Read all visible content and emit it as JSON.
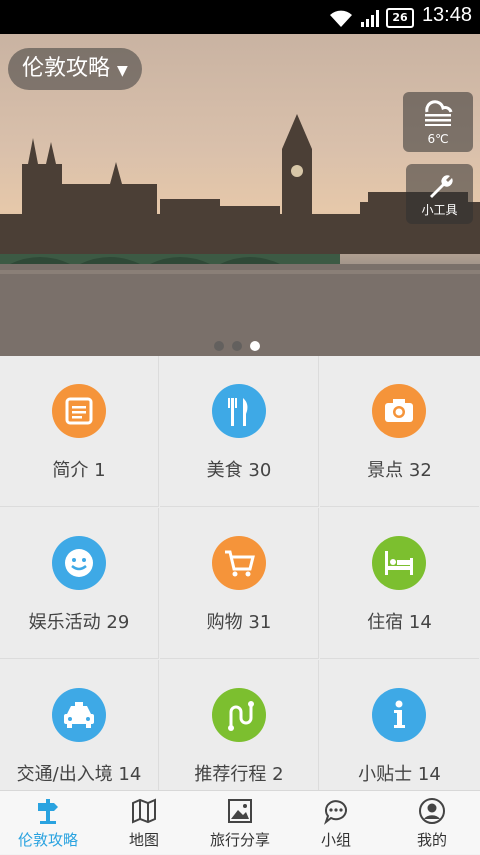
{
  "status_bar": {
    "time": "13:48",
    "battery": "26"
  },
  "hero": {
    "city_label": "伦敦攻略",
    "weather_temp": "6℃",
    "tools_label": "小工具",
    "carousel": {
      "pages": 3,
      "active_index": 2
    }
  },
  "grid": [
    {
      "label": "简介 1",
      "icon": "document-icon",
      "color": "#f5943a"
    },
    {
      "label": "美食 30",
      "icon": "fork-knife-icon",
      "color": "#3ea9e6"
    },
    {
      "label": "景点 32",
      "icon": "camera-icon",
      "color": "#f5943a"
    },
    {
      "label": "娱乐活动 29",
      "icon": "smiley-icon",
      "color": "#3ea9e6"
    },
    {
      "label": "购物 31",
      "icon": "cart-icon",
      "color": "#f5943a"
    },
    {
      "label": "住宿 14",
      "icon": "bed-icon",
      "color": "#7cbf2f"
    },
    {
      "label": "交通/出入境 14",
      "icon": "car-icon",
      "color": "#3ea9e6"
    },
    {
      "label": "推荐行程 2",
      "icon": "route-icon",
      "color": "#7cbf2f"
    },
    {
      "label": "小贴士 14",
      "icon": "info-icon",
      "color": "#3ea9e6"
    }
  ],
  "tabs": [
    {
      "label": "伦敦攻略",
      "icon": "signpost-icon",
      "active": true
    },
    {
      "label": "地图",
      "icon": "map-icon",
      "active": false
    },
    {
      "label": "旅行分享",
      "icon": "picture-icon",
      "active": false
    },
    {
      "label": "小组",
      "icon": "chat-icon",
      "active": false
    },
    {
      "label": "我的",
      "icon": "user-icon",
      "active": false
    }
  ],
  "colors": {
    "accent": "#2aa3e0",
    "orange": "#f5943a",
    "blue": "#3ea9e6",
    "green": "#7cbf2f"
  }
}
